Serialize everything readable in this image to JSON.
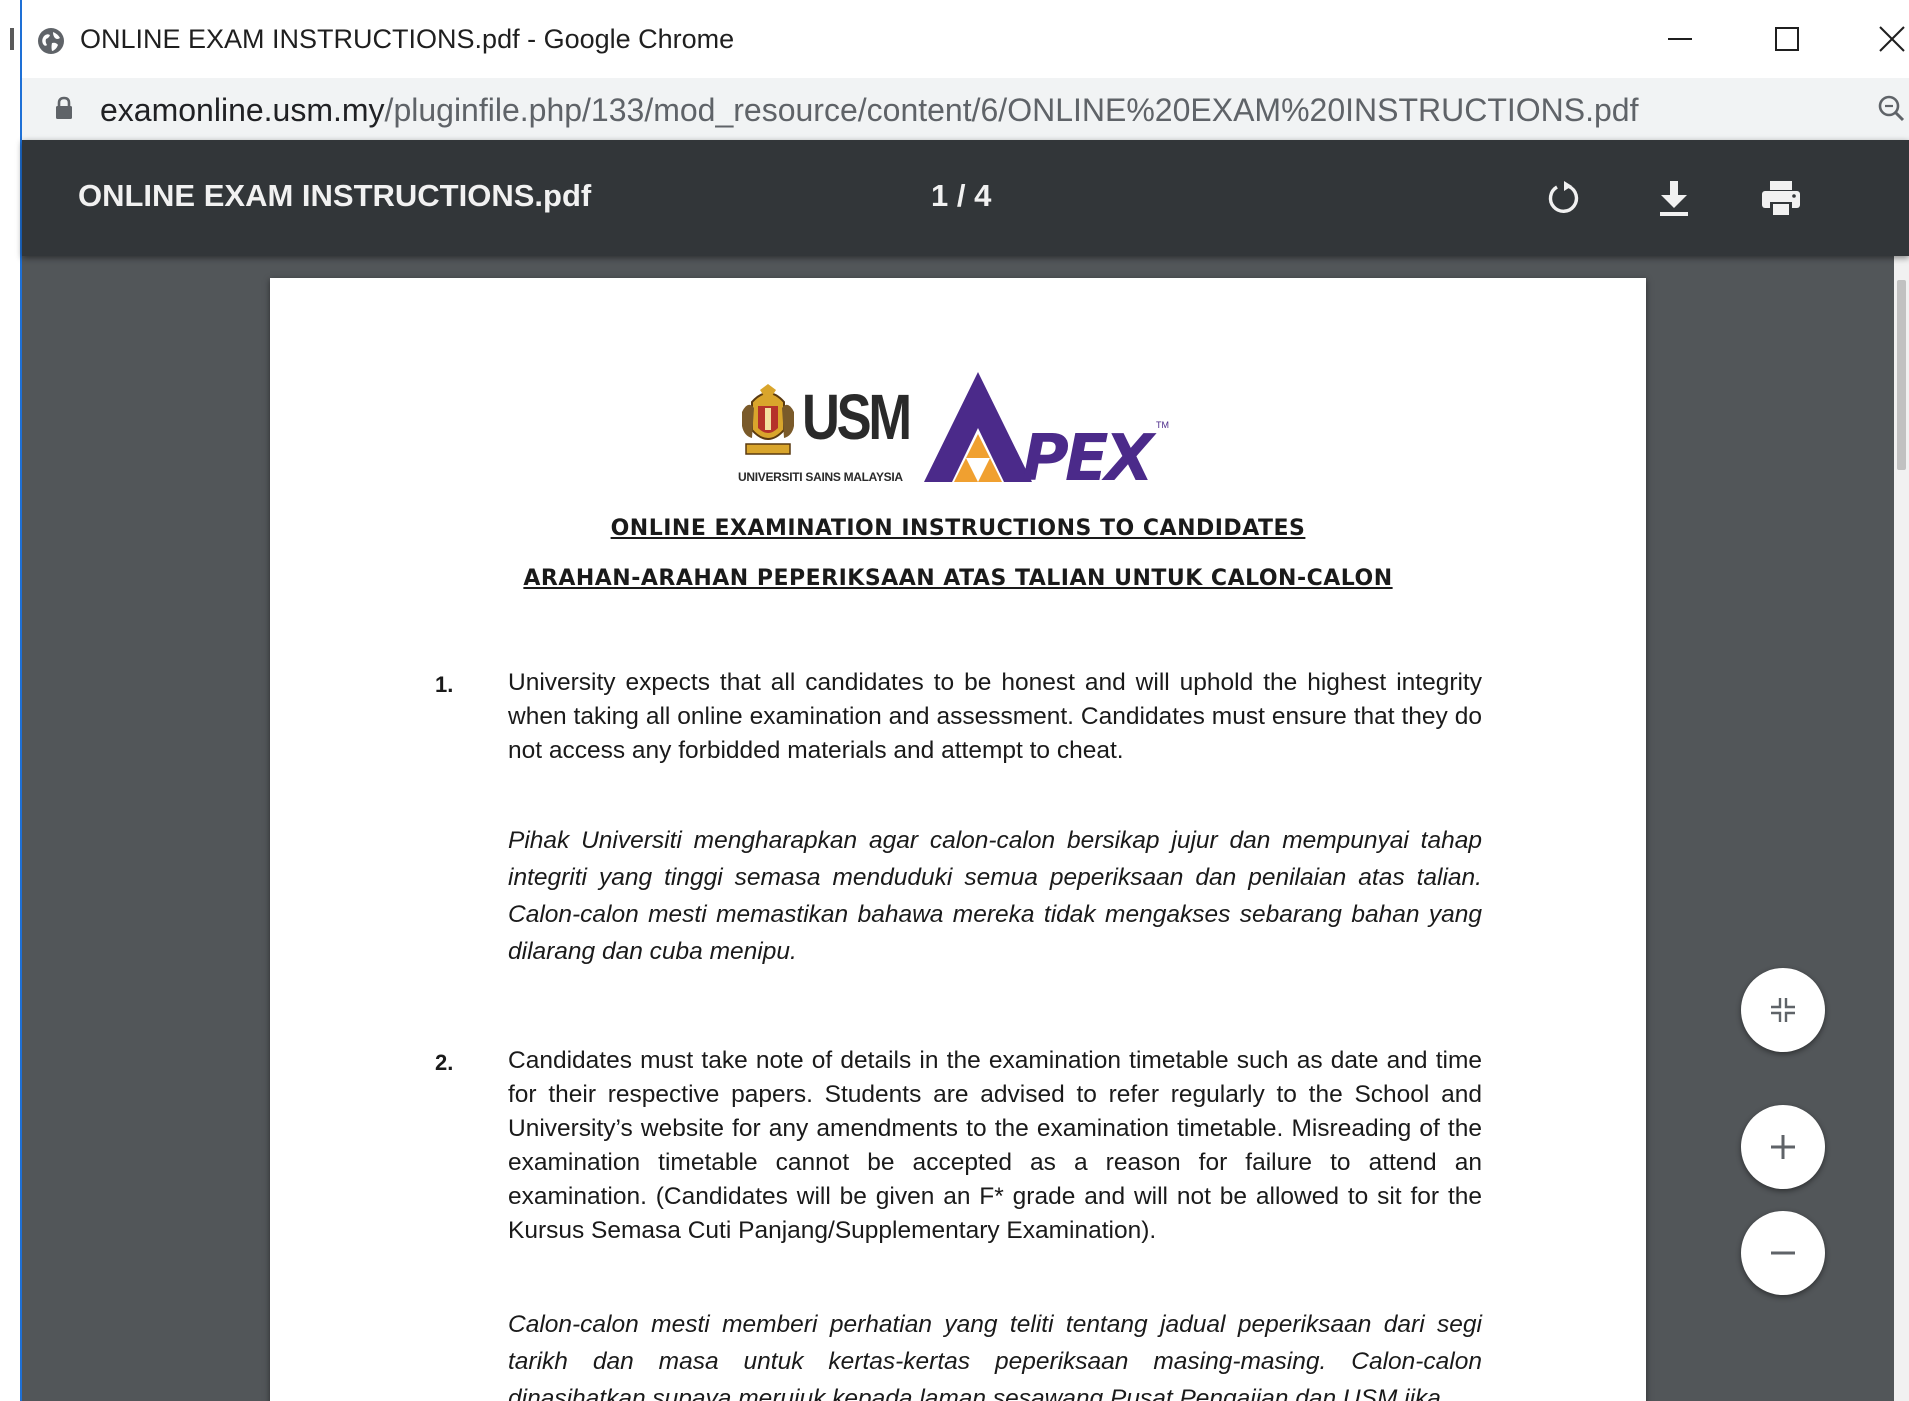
{
  "window": {
    "title": "ONLINE EXAM INSTRUCTIONS.pdf - Google Chrome"
  },
  "address_bar": {
    "host": "examonline.usm.my",
    "path": "/pluginfile.php/133/mod_resource/content/6/ONLINE%20EXAM%20INSTRUCTIONS.pdf"
  },
  "pdf_toolbar": {
    "title": "ONLINE EXAM INSTRUCTIONS.pdf",
    "page_indicator": "1 / 4"
  },
  "document": {
    "logo_usm": "USM",
    "logo_usm_sub": "UNIVERSITI SAINS MALAYSIA",
    "logo_apex": "APEX",
    "heading_en": "ONLINE EXAMINATION INSTRUCTIONS TO CANDIDATES",
    "heading_ms": "ARAHAN-ARAHAN PEPERIKSAAN ATAS TALIAN UNTUK CALON-CALON",
    "items": [
      {
        "number": "1.",
        "en": "University expects that all candidates to be honest and will uphold the highest integrity when taking all online examination and assessment. Candidates must ensure that they do not access any forbidded materials and attempt to cheat.",
        "ms": "Pihak Universiti mengharapkan agar calon-calon bersikap jujur dan mempunyai tahap integriti yang tinggi semasa menduduki semua peperiksaan dan penilaian atas talian. Calon-calon mesti memastikan bahawa mereka tidak mengakses sebarang bahan yang dilarang dan cuba menipu."
      },
      {
        "number": "2.",
        "en": "Candidates must take note of details in the examination timetable such as date and time for their respective papers. Students are advised to refer regularly to the School and University’s website for any amendments to the examination timetable. Misreading of the examination timetable cannot be accepted as a reason for failure to attend an examination. (Candidates will be given an F* grade and will not be allowed to sit for the Kursus Semasa Cuti Panjang/Supplementary Examination).",
        "ms": "Calon-calon mesti memberi perhatian yang teliti tentang jadual peperiksaan dari segi tarikh dan masa untuk kertas-kertas peperiksaan masing-masing. Calon-calon dinasihatkan supaya merujuk kepada laman sesawang Pusat Pengajian dan USM jika"
      }
    ]
  },
  "icons": {
    "globe": "globe-icon",
    "lock": "lock-icon",
    "zoom": "magnifier-icon",
    "rotate": "rotate-icon",
    "download": "download-icon",
    "print": "print-icon",
    "fit": "fit-to-page-icon",
    "zoom_in": "plus-icon",
    "zoom_out": "minus-icon"
  },
  "colors": {
    "toolbar_bg": "#323639",
    "viewer_bg": "#525659",
    "apex_purple": "#4b2a8a",
    "apex_orange": "#f0a030"
  }
}
